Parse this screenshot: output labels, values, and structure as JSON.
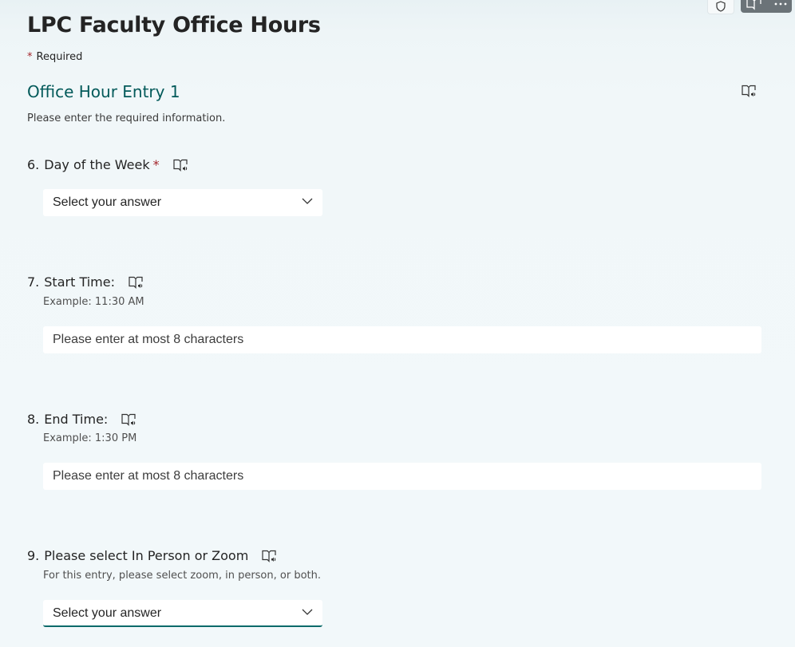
{
  "form": {
    "title": "LPC Faculty Office Hours",
    "required_star": "*",
    "required_label": "Required"
  },
  "section": {
    "title": "Office Hour Entry 1",
    "description": "Please enter the required information."
  },
  "questions": [
    {
      "number": "6.",
      "label": "Day of the Week",
      "required": "*",
      "type": "dropdown",
      "value": "Select your answer"
    },
    {
      "number": "7.",
      "label": "Start Time:",
      "hint": "Example: 11:30 AM",
      "type": "text",
      "placeholder": "Please enter at most 8 characters"
    },
    {
      "number": "8.",
      "label": "End Time:",
      "hint": "Example: 1:30 PM",
      "type": "text",
      "placeholder": "Please enter at most 8 characters"
    },
    {
      "number": "9.",
      "label": "Please select In Person or Zoom",
      "hint": "For this entry, please select zoom, in person, or both.",
      "type": "dropdown",
      "value": "Select your answer"
    }
  ],
  "icons": {
    "reader": "immersive-reader-icon",
    "chevron": "chevron-down-icon",
    "shield": "shield-icon",
    "more": "more-icon"
  },
  "colors": {
    "accent": "#0b6a6a",
    "section_title": "#035a5a",
    "required": "#a4262c"
  }
}
